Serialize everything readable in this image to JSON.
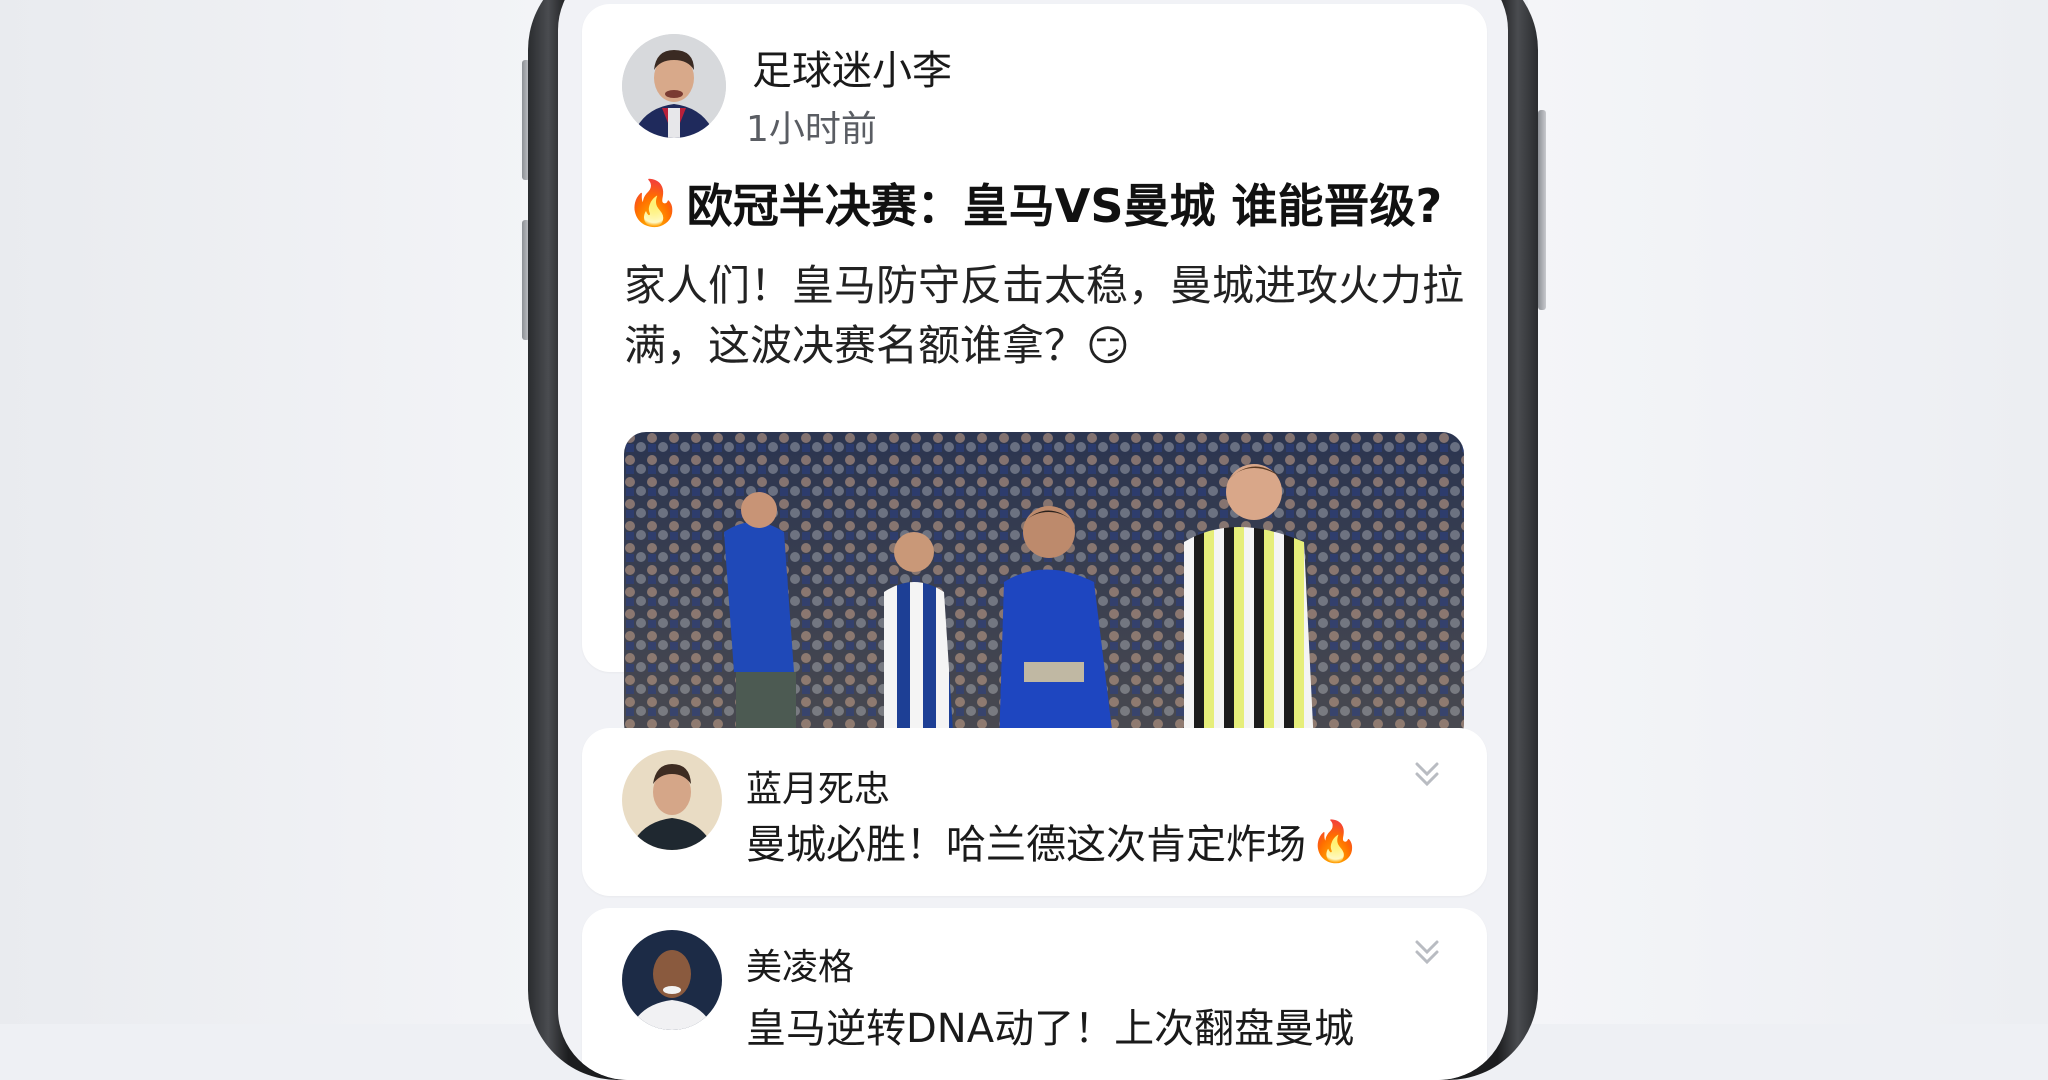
{
  "post": {
    "author": "足球迷小李",
    "time": "1小时前",
    "title_emoji": "🔥",
    "title": "欧冠半决赛：皇马VS曼城 谁能晋级?",
    "body": "家人们！皇马防守反击太稳，曼城进攻火力拉满，这波决赛名额谁拿？😏"
  },
  "comments": [
    {
      "author": "蓝月死忠",
      "text": "曼城必胜！哈兰德这次肯定炸场",
      "emoji": "🔥"
    },
    {
      "author": "美凌格",
      "text": "皇马逆转DNA动了！上次翻盘曼城"
    }
  ],
  "colors": {
    "background": "#eef0f4",
    "screen": "#f1f2f6",
    "card": "#ffffff",
    "text_primary": "#1a1a1a",
    "text_secondary": "#5a5d63"
  },
  "icons": {
    "fire": "fire-icon",
    "chevron": "chevron-down-icon"
  }
}
